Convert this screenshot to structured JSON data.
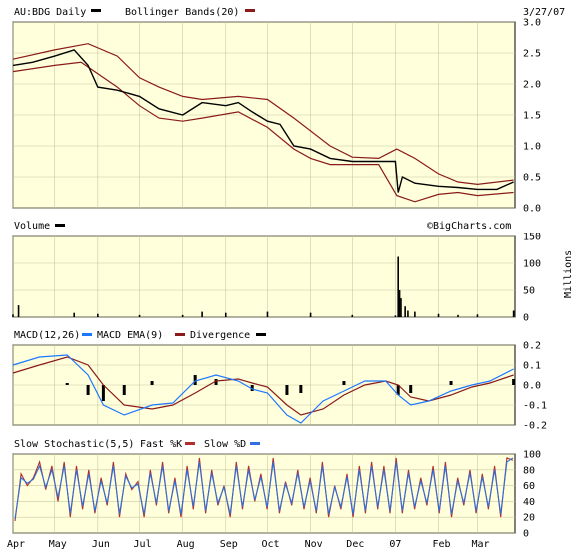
{
  "header": {
    "symbol_label": "AU:BDG Daily",
    "overlay_label": "Bollinger Bands(20)",
    "date": "3/27/07"
  },
  "watermark": "©BigCharts.com",
  "colors": {
    "background": "#ffffdc",
    "price": "#000000",
    "bollinger": "#8b1a1a",
    "macd": "#1e78ff",
    "divergence": "#000000",
    "grid": "#c8c8a0",
    "stoch_fast": "#b03030",
    "stoch_slow": "#2f6fde"
  },
  "chart_data": [
    {
      "type": "line",
      "panel": "price",
      "title": "AU:BDG Daily",
      "ylim": [
        0,
        3.0
      ],
      "yticks": [
        "0.0",
        "0.5",
        "1.0",
        "1.5",
        "2.0",
        "2.5",
        "3.0"
      ],
      "xticks": [
        "Apr",
        "May",
        "Jun",
        "Jul",
        "Aug",
        "Sep",
        "Oct",
        "Nov",
        "Dec",
        "07",
        "Feb",
        "Mar"
      ],
      "grid": true,
      "series": [
        {
          "name": "AU:BDG Daily",
          "x": [
            "2006-04-01",
            "2006-04-15",
            "2006-05-01",
            "2006-05-15",
            "2006-05-25",
            "2006-06-01",
            "2006-06-15",
            "2006-07-01",
            "2006-07-15",
            "2006-08-01",
            "2006-08-15",
            "2006-09-01",
            "2006-09-10",
            "2006-09-20",
            "2006-10-01",
            "2006-10-10",
            "2006-10-20",
            "2006-11-01",
            "2006-11-15",
            "2006-12-01",
            "2006-12-15",
            "2007-01-01",
            "2007-01-03",
            "2007-01-06",
            "2007-01-15",
            "2007-02-01",
            "2007-02-15",
            "2007-03-01",
            "2007-03-15",
            "2007-03-27"
          ],
          "values": [
            2.3,
            2.35,
            2.45,
            2.55,
            2.3,
            1.95,
            1.9,
            1.8,
            1.6,
            1.5,
            1.7,
            1.65,
            1.7,
            1.55,
            1.4,
            1.35,
            1.0,
            0.95,
            0.8,
            0.75,
            0.75,
            0.75,
            0.25,
            0.5,
            0.4,
            0.35,
            0.33,
            0.3,
            0.3,
            0.42
          ]
        },
        {
          "name": "Bollinger Bands(20) Upper",
          "x": [
            "2006-04-01",
            "2006-05-01",
            "2006-05-25",
            "2006-06-15",
            "2006-07-01",
            "2006-07-15",
            "2006-08-01",
            "2006-08-15",
            "2006-09-10",
            "2006-10-01",
            "2006-10-20",
            "2006-11-15",
            "2006-12-01",
            "2006-12-20",
            "2007-01-02",
            "2007-01-15",
            "2007-02-01",
            "2007-02-15",
            "2007-03-01",
            "2007-03-27"
          ],
          "values": [
            2.4,
            2.55,
            2.65,
            2.45,
            2.1,
            1.95,
            1.8,
            1.75,
            1.8,
            1.75,
            1.45,
            1.0,
            0.82,
            0.8,
            0.95,
            0.8,
            0.55,
            0.42,
            0.38,
            0.45
          ]
        },
        {
          "name": "Bollinger Bands(20) Lower",
          "x": [
            "2006-04-01",
            "2006-05-01",
            "2006-05-20",
            "2006-06-15",
            "2006-07-01",
            "2006-07-15",
            "2006-08-01",
            "2006-08-15",
            "2006-09-10",
            "2006-10-01",
            "2006-10-20",
            "2006-11-01",
            "2006-11-15",
            "2006-12-01",
            "2006-12-20",
            "2007-01-02",
            "2007-01-15",
            "2007-02-01",
            "2007-02-15",
            "2007-03-01",
            "2007-03-27"
          ],
          "values": [
            2.2,
            2.3,
            2.35,
            1.95,
            1.65,
            1.45,
            1.4,
            1.45,
            1.55,
            1.3,
            0.95,
            0.8,
            0.7,
            0.7,
            0.7,
            0.2,
            0.1,
            0.22,
            0.25,
            0.2,
            0.25
          ]
        }
      ]
    },
    {
      "type": "bar",
      "panel": "volume",
      "title": "Volume",
      "ylabel": "Millions",
      "ylim": [
        0,
        150
      ],
      "yticks": [
        "0",
        "50",
        "100",
        "150"
      ],
      "grid": true,
      "series": [
        {
          "name": "Volume",
          "x": [
            "2006-04-01",
            "2006-04-05",
            "2006-05-15",
            "2006-06-01",
            "2006-07-01",
            "2006-08-01",
            "2006-08-15",
            "2006-09-01",
            "2006-10-01",
            "2006-11-01",
            "2006-12-01",
            "2007-01-01",
            "2007-01-03",
            "2007-01-04",
            "2007-01-05",
            "2007-01-08",
            "2007-01-10",
            "2007-01-15",
            "2007-02-01",
            "2007-02-15",
            "2007-03-01",
            "2007-03-27"
          ],
          "values": [
            5,
            22,
            8,
            6,
            4,
            4,
            10,
            8,
            10,
            8,
            4,
            3,
            112,
            50,
            35,
            20,
            12,
            10,
            6,
            4,
            5,
            12
          ]
        }
      ]
    },
    {
      "type": "line",
      "panel": "macd",
      "title": "MACD(12,26)",
      "ylim": [
        -0.2,
        0.2
      ],
      "yticks": [
        "0.2",
        "0.1",
        "0.0",
        "-0.1",
        "-0.2"
      ],
      "grid": true,
      "series": [
        {
          "name": "MACD(12,26)",
          "x": [
            "2006-04-01",
            "2006-04-20",
            "2006-05-10",
            "2006-05-25",
            "2006-06-05",
            "2006-06-20",
            "2006-07-10",
            "2006-07-25",
            "2006-08-10",
            "2006-08-25",
            "2006-09-10",
            "2006-09-20",
            "2006-10-01",
            "2006-10-15",
            "2006-10-25",
            "2006-11-10",
            "2006-11-25",
            "2006-12-10",
            "2006-12-25",
            "2007-01-03",
            "2007-01-12",
            "2007-01-25",
            "2007-02-10",
            "2007-02-25",
            "2007-03-10",
            "2007-03-27"
          ],
          "values": [
            0.1,
            0.14,
            0.15,
            0.05,
            -0.1,
            -0.15,
            -0.1,
            -0.09,
            0.02,
            0.05,
            0.02,
            -0.02,
            -0.04,
            -0.15,
            -0.19,
            -0.08,
            -0.03,
            0.02,
            0.02,
            -0.05,
            -0.1,
            -0.08,
            -0.03,
            0.0,
            0.02,
            0.08
          ]
        },
        {
          "name": "MACD EMA(9)",
          "x": [
            "2006-04-01",
            "2006-04-20",
            "2006-05-10",
            "2006-05-25",
            "2006-06-05",
            "2006-06-20",
            "2006-07-10",
            "2006-07-25",
            "2006-08-10",
            "2006-08-25",
            "2006-09-10",
            "2006-09-20",
            "2006-10-01",
            "2006-10-15",
            "2006-10-25",
            "2006-11-10",
            "2006-11-25",
            "2006-12-10",
            "2006-12-25",
            "2007-01-03",
            "2007-01-12",
            "2007-01-25",
            "2007-02-10",
            "2007-02-25",
            "2007-03-10",
            "2007-03-27"
          ],
          "values": [
            0.06,
            0.1,
            0.14,
            0.1,
            0.0,
            -0.1,
            -0.12,
            -0.1,
            -0.04,
            0.02,
            0.03,
            0.01,
            -0.01,
            -0.1,
            -0.15,
            -0.12,
            -0.05,
            0.0,
            0.02,
            0.0,
            -0.06,
            -0.08,
            -0.05,
            -0.01,
            0.01,
            0.05
          ]
        },
        {
          "name": "Divergence",
          "x": [
            "2006-04-01",
            "2006-05-10",
            "2006-05-25",
            "2006-06-05",
            "2006-06-20",
            "2006-07-10",
            "2006-08-10",
            "2006-08-25",
            "2006-09-20",
            "2006-10-15",
            "2006-10-25",
            "2006-11-25",
            "2006-12-25",
            "2007-01-03",
            "2007-01-12",
            "2007-02-10",
            "2007-03-27"
          ],
          "values": [
            0.0,
            0.01,
            -0.05,
            -0.08,
            -0.05,
            0.02,
            0.05,
            0.03,
            -0.03,
            -0.05,
            -0.04,
            0.02,
            0.0,
            -0.05,
            -0.04,
            0.02,
            0.03
          ]
        }
      ]
    },
    {
      "type": "line",
      "panel": "stochastic",
      "title": "Slow Stochastic(5,5)",
      "ylim": [
        0,
        100
      ],
      "yticks": [
        "100",
        "80",
        "60",
        "40",
        "20",
        "0"
      ],
      "grid": true,
      "series": [
        {
          "name": "Fast %K",
          "values": [
            15,
            75,
            60,
            70,
            90,
            55,
            85,
            40,
            90,
            20,
            85,
            30,
            80,
            25,
            70,
            35,
            90,
            20,
            75,
            55,
            65,
            20,
            80,
            35,
            90,
            25,
            70,
            20,
            85,
            30,
            95,
            25,
            80,
            35,
            60,
            20,
            90,
            30,
            85,
            40,
            75,
            30,
            95,
            25,
            65,
            35,
            80,
            30,
            70,
            25,
            90,
            20,
            60,
            30,
            75,
            20,
            85,
            25,
            90,
            30,
            85,
            25,
            95,
            25,
            80,
            30,
            70,
            35,
            85,
            25,
            90,
            20,
            70,
            35,
            80,
            25,
            75,
            30,
            85,
            20,
            95,
            92
          ]
        },
        {
          "name": "Slow %D",
          "values": [
            18,
            70,
            63,
            68,
            85,
            58,
            80,
            45,
            85,
            25,
            80,
            34,
            75,
            28,
            66,
            38,
            85,
            24,
            72,
            57,
            62,
            24,
            76,
            38,
            85,
            28,
            66,
            24,
            80,
            34,
            90,
            28,
            76,
            38,
            58,
            24,
            85,
            33,
            80,
            42,
            71,
            33,
            90,
            28,
            62,
            38,
            76,
            33,
            66,
            28,
            85,
            24,
            58,
            33,
            71,
            24,
            80,
            28,
            85,
            33,
            80,
            28,
            90,
            28,
            76,
            33,
            66,
            38,
            80,
            28,
            85,
            24,
            66,
            38,
            76,
            28,
            71,
            33,
            80,
            24,
            90,
            95
          ]
        }
      ]
    }
  ]
}
